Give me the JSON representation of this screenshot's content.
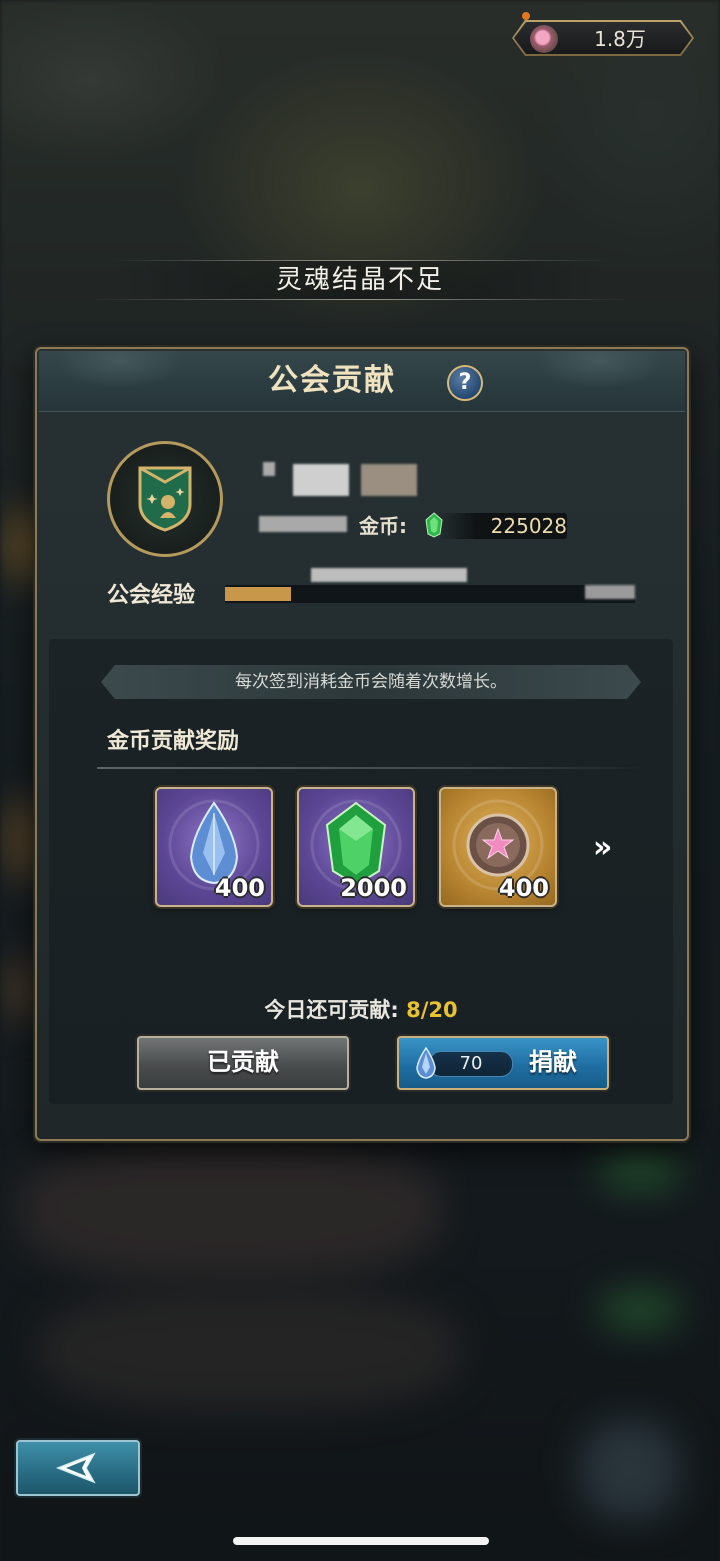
{
  "topbar": {
    "currency_value": "1.8万",
    "currency_icon": "soul-crystal-icon"
  },
  "banner": {
    "message": "灵魂结晶不足"
  },
  "panel": {
    "title": "公会贡献",
    "help_label": "?",
    "coins": {
      "label": "金币:",
      "value": "225028"
    },
    "guild_exp": {
      "label": "公会经验",
      "progress": 0.16
    },
    "hint": "每次签到消耗金币会随着次数增长。",
    "rewards": {
      "title": "金币贡献奖励",
      "items": [
        {
          "icon": "blue-crystal-icon",
          "count": "400",
          "frame": "purple"
        },
        {
          "icon": "green-gem-icon",
          "count": "2000",
          "frame": "purple"
        },
        {
          "icon": "soul-crystal-icon",
          "count": "400",
          "frame": "gold"
        }
      ],
      "more_label": "»"
    },
    "today": {
      "label": "今日还可贡献:",
      "value": "8/20"
    },
    "buttons": {
      "contributed_label": "已贡献",
      "donate_label": "捐献",
      "donate_cost": "70"
    }
  },
  "colors": {
    "panel_border": "#8d7a52",
    "highlight": "#e8c232",
    "donate_button": "#1f6fa3"
  }
}
